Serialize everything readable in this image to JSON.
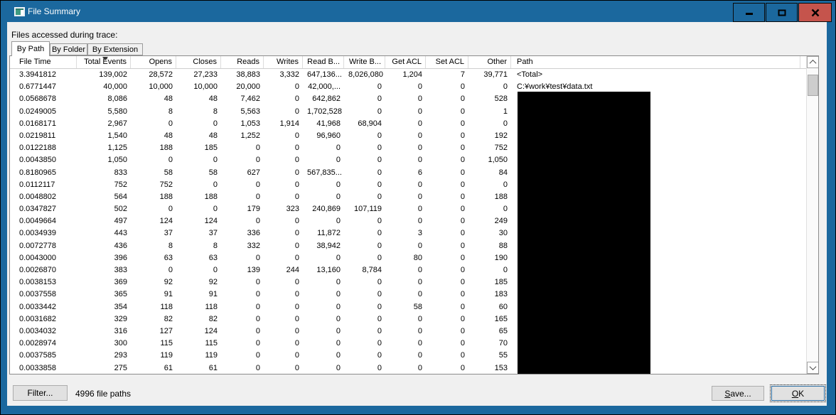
{
  "window": {
    "title": "File Summary"
  },
  "colors": {
    "titlebar": "#1b689e",
    "close_button": "#c5544c",
    "dialog_bg": "#f0f0f0"
  },
  "icons": {
    "app": "file-summary-window-icon",
    "minimize": "minus",
    "maximize": "square-outline",
    "close": "x-cross",
    "scroll_up": "chevron-up",
    "scroll_down": "chevron-down",
    "sort_indicator": "triangle-down"
  },
  "intro_label": "Files accessed during trace:",
  "tabs": [
    {
      "label": "By Path",
      "active": true
    },
    {
      "label": "By Folder",
      "active": false
    },
    {
      "label": "By Extension",
      "active": false
    }
  ],
  "table": {
    "sorted_column": "Total Events",
    "columns": [
      {
        "label": "File Time",
        "align": "left"
      },
      {
        "label": "Total Events",
        "align": "right"
      },
      {
        "label": "Opens",
        "align": "right"
      },
      {
        "label": "Closes",
        "align": "right"
      },
      {
        "label": "Reads",
        "align": "right"
      },
      {
        "label": "Writes",
        "align": "right"
      },
      {
        "label": "Read B...",
        "align": "right"
      },
      {
        "label": "Write B...",
        "align": "right"
      },
      {
        "label": "Get ACL",
        "align": "right"
      },
      {
        "label": "Set ACL",
        "align": "right"
      },
      {
        "label": "Other",
        "align": "right"
      },
      {
        "label": "Path",
        "align": "left"
      }
    ],
    "rows": [
      [
        "3.3941812",
        "139,002",
        "28,572",
        "27,233",
        "38,883",
        "3,332",
        "647,136...",
        "8,026,080",
        "1,204",
        "7",
        "39,771",
        "<Total>"
      ],
      [
        "0.6771447",
        "40,000",
        "10,000",
        "10,000",
        "20,000",
        "0",
        "42,000,...",
        "0",
        "0",
        "0",
        "0",
        "C:¥work¥test¥data.txt"
      ],
      [
        "0.0568678",
        "8,086",
        "48",
        "48",
        "7,462",
        "0",
        "642,862",
        "0",
        "0",
        "0",
        "528",
        ""
      ],
      [
        "0.0249005",
        "5,580",
        "8",
        "8",
        "5,563",
        "0",
        "1,702,528",
        "0",
        "0",
        "0",
        "1",
        ""
      ],
      [
        "0.0168171",
        "2,967",
        "0",
        "0",
        "1,053",
        "1,914",
        "41,968",
        "68,904",
        "0",
        "0",
        "0",
        ""
      ],
      [
        "0.0219811",
        "1,540",
        "48",
        "48",
        "1,252",
        "0",
        "96,960",
        "0",
        "0",
        "0",
        "192",
        ""
      ],
      [
        "0.0122188",
        "1,125",
        "188",
        "185",
        "0",
        "0",
        "0",
        "0",
        "0",
        "0",
        "752",
        ""
      ],
      [
        "0.0043850",
        "1,050",
        "0",
        "0",
        "0",
        "0",
        "0",
        "0",
        "0",
        "0",
        "1,050",
        ""
      ],
      [
        "0.8180965",
        "833",
        "58",
        "58",
        "627",
        "0",
        "567,835...",
        "0",
        "6",
        "0",
        "84",
        ""
      ],
      [
        "0.0112117",
        "752",
        "752",
        "0",
        "0",
        "0",
        "0",
        "0",
        "0",
        "0",
        "0",
        ""
      ],
      [
        "0.0048802",
        "564",
        "188",
        "188",
        "0",
        "0",
        "0",
        "0",
        "0",
        "0",
        "188",
        ""
      ],
      [
        "0.0347827",
        "502",
        "0",
        "0",
        "179",
        "323",
        "240,869",
        "107,119",
        "0",
        "0",
        "0",
        ""
      ],
      [
        "0.0049664",
        "497",
        "124",
        "124",
        "0",
        "0",
        "0",
        "0",
        "0",
        "0",
        "249",
        ""
      ],
      [
        "0.0034939",
        "443",
        "37",
        "37",
        "336",
        "0",
        "11,872",
        "0",
        "3",
        "0",
        "30",
        ""
      ],
      [
        "0.0072778",
        "436",
        "8",
        "8",
        "332",
        "0",
        "38,942",
        "0",
        "0",
        "0",
        "88",
        ""
      ],
      [
        "0.0043000",
        "396",
        "63",
        "63",
        "0",
        "0",
        "0",
        "0",
        "80",
        "0",
        "190",
        ""
      ],
      [
        "0.0026870",
        "383",
        "0",
        "0",
        "139",
        "244",
        "13,160",
        "8,784",
        "0",
        "0",
        "0",
        ""
      ],
      [
        "0.0038153",
        "369",
        "92",
        "92",
        "0",
        "0",
        "0",
        "0",
        "0",
        "0",
        "185",
        ""
      ],
      [
        "0.0037558",
        "365",
        "91",
        "91",
        "0",
        "0",
        "0",
        "0",
        "0",
        "0",
        "183",
        ""
      ],
      [
        "0.0033442",
        "354",
        "118",
        "118",
        "0",
        "0",
        "0",
        "0",
        "58",
        "0",
        "60",
        ""
      ],
      [
        "0.0031682",
        "329",
        "82",
        "82",
        "0",
        "0",
        "0",
        "0",
        "0",
        "0",
        "165",
        ""
      ],
      [
        "0.0034032",
        "316",
        "127",
        "124",
        "0",
        "0",
        "0",
        "0",
        "0",
        "0",
        "65",
        ""
      ],
      [
        "0.0028974",
        "300",
        "115",
        "115",
        "0",
        "0",
        "0",
        "0",
        "0",
        "0",
        "70",
        ""
      ],
      [
        "0.0037585",
        "293",
        "119",
        "119",
        "0",
        "0",
        "0",
        "0",
        "0",
        "0",
        "55",
        ""
      ],
      [
        "0.0033858",
        "275",
        "61",
        "61",
        "0",
        "0",
        "0",
        "0",
        "0",
        "0",
        "153",
        ""
      ]
    ]
  },
  "footer": {
    "filter_label": "Filter...",
    "count_text": "4996 file paths",
    "save_label": "Save...",
    "ok_label": "OK"
  }
}
